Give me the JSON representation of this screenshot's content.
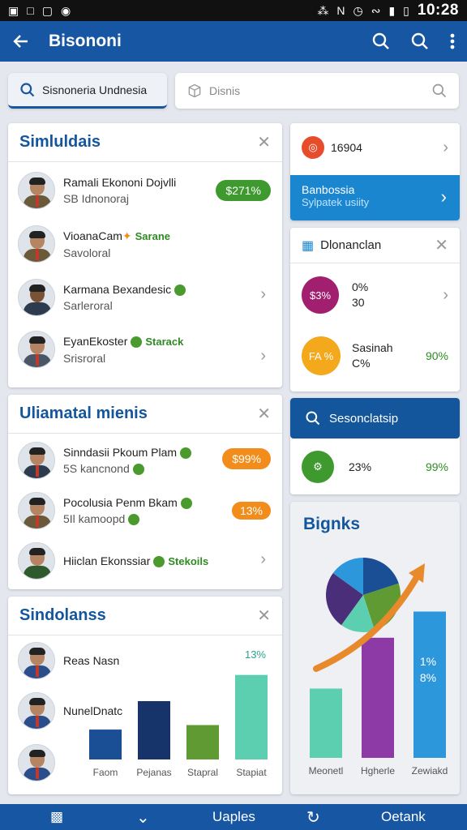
{
  "status_bar": {
    "time": "10:28"
  },
  "app_bar": {
    "title": "Bisononi"
  },
  "search": {
    "left_label": "Sisnoneria Undnesia",
    "right_placeholder": "Disnis"
  },
  "card1": {
    "title": "Simluldais",
    "people": [
      {
        "name": "Ramali Ekononi Dojvlli",
        "sub": "SB Idnonoraj",
        "badge": "$271%",
        "badge_color": "#3e9a2f"
      },
      {
        "name": "VioanaCam",
        "tag": "Sarane",
        "sub": "Savoloral"
      },
      {
        "name": "Karmana Bexandesic",
        "sub": "Sarleroral"
      },
      {
        "name": "EyanEkoster",
        "tag": "Starack",
        "sub": "Srisroral"
      }
    ]
  },
  "card2": {
    "title": "Uliamatal mienis",
    "people": [
      {
        "name": "Sinndasii Pkoum Plam",
        "sub": "5S kancnond",
        "badge": "$99%",
        "badge_color": "#f28c1a"
      },
      {
        "name": "Pocolusia Penm Bkam",
        "sub": "5Il kamoopd",
        "badge": "13%",
        "badge_color": "#f28c1a"
      },
      {
        "name": "Hiiclan Ekonssiar",
        "tag": "Stekoils"
      }
    ]
  },
  "card3": {
    "title": "Sindolanss",
    "people": [
      {
        "name": "Reas Nasn"
      },
      {
        "name": "NunelDnatc"
      },
      {
        "name": ""
      }
    ]
  },
  "right1": {
    "row1_value": "16904",
    "highlight_title": "Banbossia",
    "highlight_sub": "Sylpatek usiity"
  },
  "right2": {
    "title": "Dlonanclan",
    "row1_circle": "$3%",
    "row1_line1": "0%",
    "row1_line2": "30",
    "row2_circle": "FA %",
    "row2_line1": "Sasinah",
    "row2_line2": "C%",
    "row2_value": "90%"
  },
  "right3": {
    "search_label": "Sesonclatsip",
    "row_value": "23%",
    "row_value2": "99%"
  },
  "chart_left": {
    "labels": {
      "y_top": "13%"
    },
    "chart_data": {
      "type": "bar",
      "categories": [
        "Faom",
        "Pejanas",
        "Stapral",
        "Stapiat"
      ],
      "values": [
        40,
        78,
        46,
        113
      ],
      "ylim": [
        0,
        130
      ],
      "colors": [
        "#1a4f96",
        "#16346a",
        "#5f9a32",
        "#5ccfb0"
      ]
    }
  },
  "chart_right": {
    "title": "Bignks",
    "label_1": "1%",
    "label_2": "8%",
    "chart_data": {
      "type": "bar",
      "categories": [
        "Meonetl",
        "Hgherle",
        "Zewiakd"
      ],
      "values": [
        45,
        78,
        95
      ],
      "ylim": [
        0,
        100
      ],
      "colors": [
        "#5ccfb0",
        "#8e3aa6",
        "#2d97dc"
      ],
      "pie_colors": [
        "#1a4f96",
        "#5f9a32",
        "#5ccfb0",
        "#4a2e7a",
        "#2d97dc"
      ],
      "pie_values": [
        20,
        25,
        15,
        25,
        15
      ]
    }
  },
  "bottom_nav": {
    "label_1": "Uaples",
    "label_2": "Oetank"
  },
  "colors": {
    "primary": "#1656a3",
    "green": "#3e9a2f",
    "orange": "#f28c1a"
  }
}
